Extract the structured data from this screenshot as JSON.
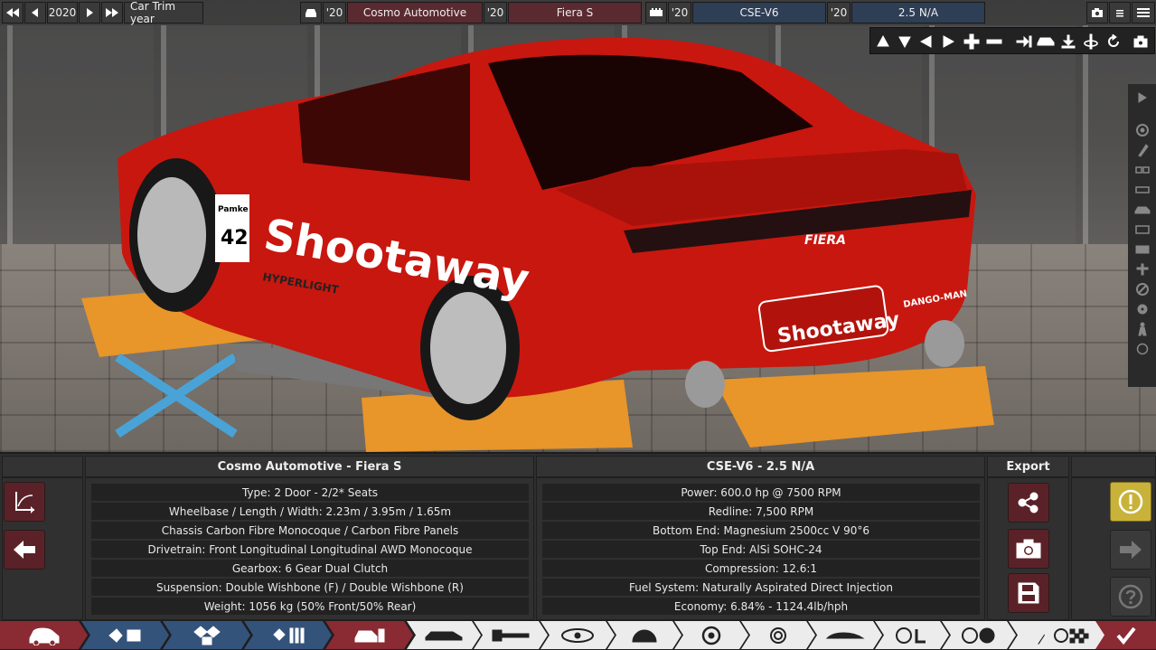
{
  "topbar": {
    "year": "2020",
    "trim_label": "Car Trim year",
    "model_year_label": "'20",
    "model_name": "Cosmo Automotive",
    "trim_year_label": "'20",
    "trim_name": "Fiera S",
    "engine_year_label": "'20",
    "engine_family": "CSE-V6",
    "variant_year_label": "'20",
    "engine_variant": "2.5 N/A"
  },
  "scene": {
    "livery_text": "Shootaway",
    "plate_text": "Shootaway",
    "race_number": "42",
    "number_label": "Pamke",
    "badge_text": "FIERA",
    "dealer_text": "DANGO-MAN",
    "sponsor_text": "HYPERLIGHT"
  },
  "car_panel": {
    "title": "Cosmo Automotive - Fiera S",
    "rows": [
      "Type: 2 Door - 2/2* Seats",
      "Wheelbase / Length / Width: 2.23m / 3.95m / 1.65m",
      "Chassis Carbon Fibre Monocoque / Carbon Fibre Panels",
      "Drivetrain: Front Longitudinal Longitudinal AWD Monocoque",
      "Gearbox: 6 Gear Dual Clutch",
      "Suspension: Double Wishbone (F) / Double Wishbone (R)",
      "Weight: 1056 kg (50% Front/50% Rear)"
    ]
  },
  "engine_panel": {
    "title": "CSE-V6 - 2.5 N/A",
    "rows": [
      "Power: 600.0 hp @ 7500 RPM",
      "Redline:  7,500 RPM",
      "Bottom End: Magnesium 2500cc V 90°6",
      "Top End: AlSi SOHC-24",
      "Compression: 12.6:1",
      "Fuel System: Naturally Aspirated Direct Injection",
      "Economy: 6.84% - 1124.4lb/hph"
    ]
  },
  "export_panel": {
    "title": "Export"
  },
  "colors": {
    "accent_red": "#6b2a30",
    "accent_blue": "#2d3e55",
    "warning": "#c9b23a",
    "car_red": "#c8170f"
  },
  "icons": {
    "tabs": [
      "car-body-icon",
      "engine-block-icon",
      "engine-head-icon",
      "engine-tune-icon",
      "car-layout-icon",
      "chassis-icon",
      "gearbox-icon",
      "headlight-icon",
      "suspension-icon",
      "wheel-icon",
      "brake-icon",
      "aero-icon",
      "interior-icon",
      "steering-icon",
      "fuel-icon",
      "tuning-icon",
      "finish-icon"
    ]
  }
}
